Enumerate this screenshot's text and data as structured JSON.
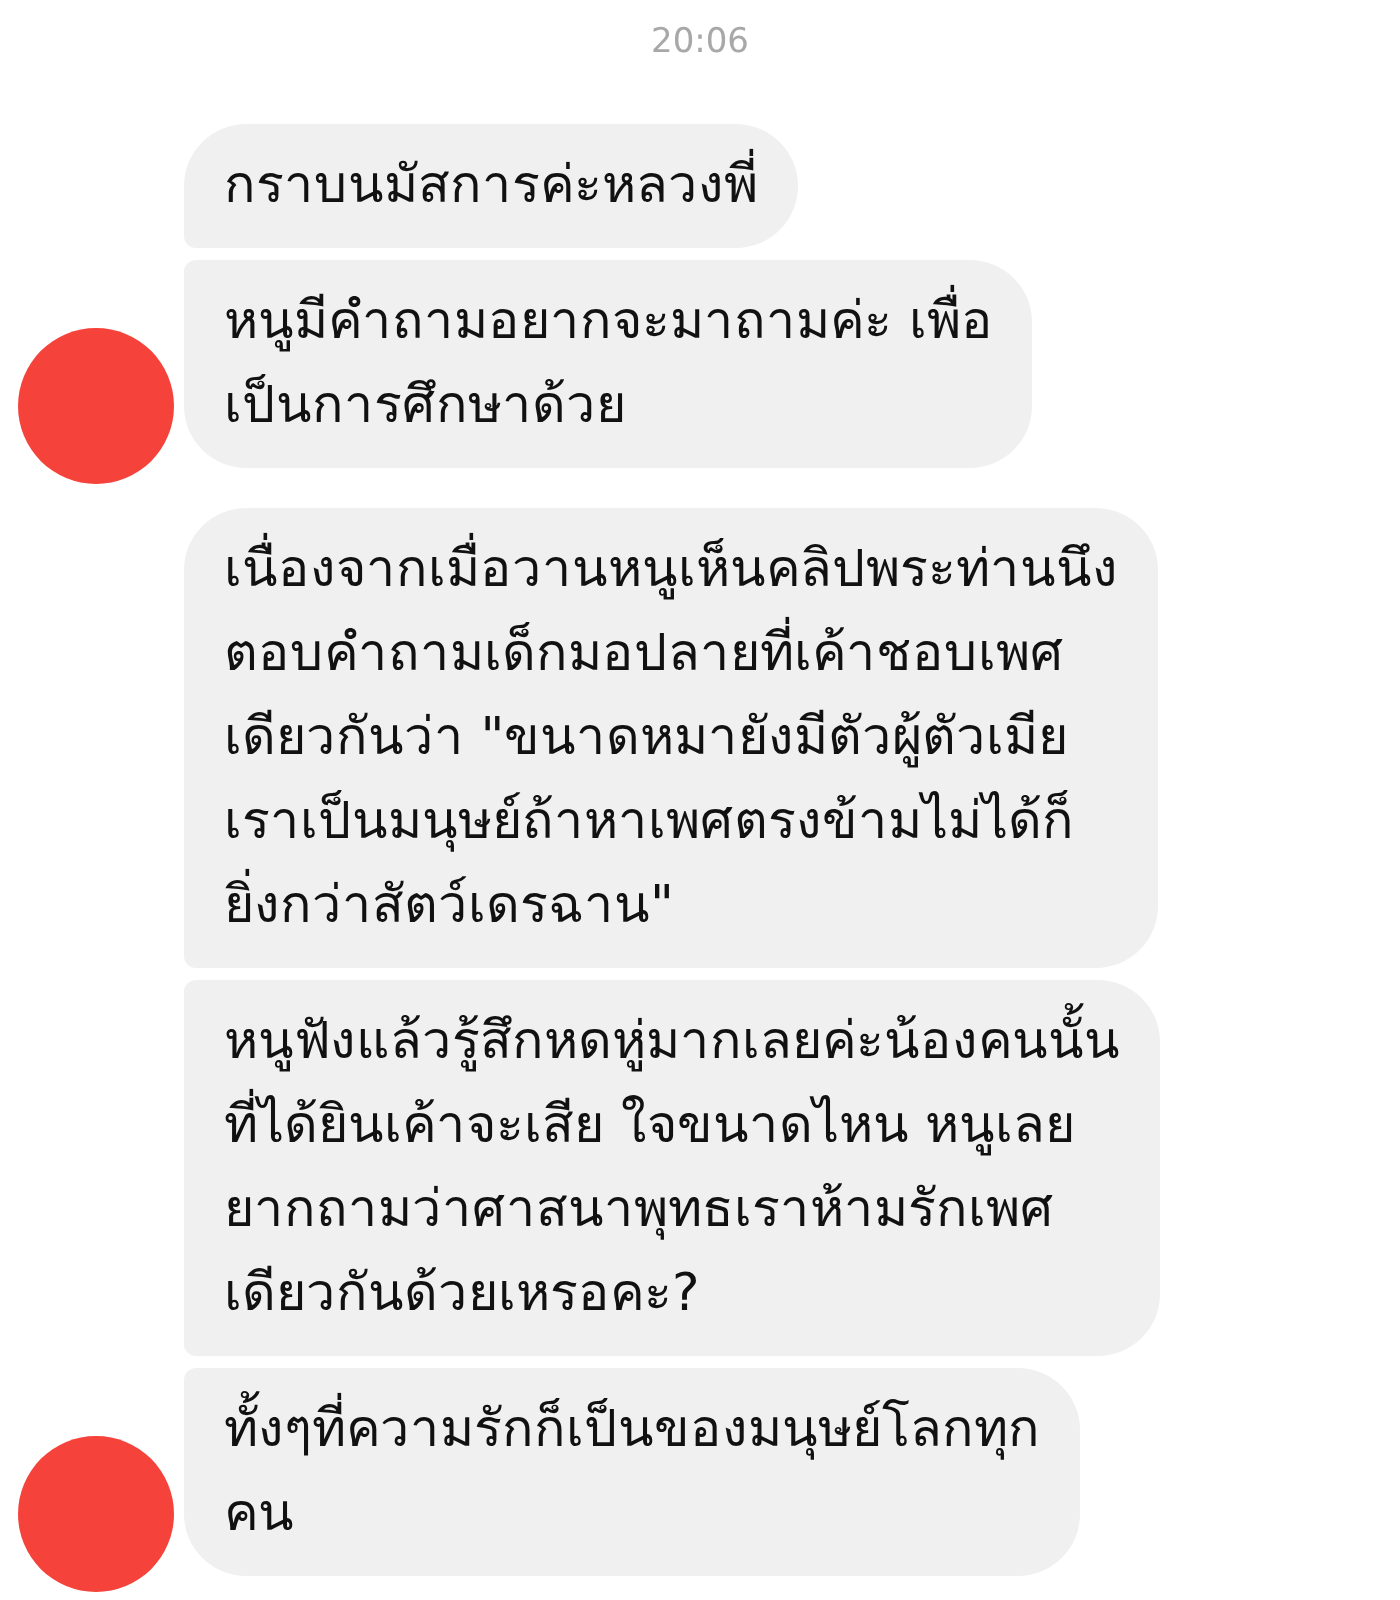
{
  "timestamp": "20:06",
  "groups": [
    {
      "messages": [
        {
          "text": "กราบนมัสการค่ะหลวงพี่"
        },
        {
          "text": "หนูมีคำถามอยากจะมาถามค่ะ เพื่อ\nเป็นการศึกษาด้วย"
        }
      ]
    },
    {
      "messages": [
        {
          "text": "เนื่องจากเมื่อวานหนูเห็นคลิปพระท่านนึง\nตอบคำถามเด็กมอปลายที่เค้าชอบเพศ\nเดียวกันว่า \"ขนาดหมายังมีตัวผู้ตัวเมีย\nเราเป็นมนุษย์ถ้าหาเพศตรงข้ามไม่ได้ก็\nยิ่งกว่าสัตว์เดรฉาน\""
        },
        {
          "text": "หนูฟังแล้วรู้สึกหดหู่มากเลยค่ะน้องคนนั้น\nที่ได้ยินเค้าจะเสีย ใจขนาดไหน หนูเลย\nยากถามว่าศาสนาพุทธเราห้ามรักเพศ\nเดียวกันด้วยเหรอคะ?"
        },
        {
          "text": "ทั้งๆที่ความรักก็เป็นของมนุษย์โลกทุก\nคน"
        }
      ]
    }
  ]
}
